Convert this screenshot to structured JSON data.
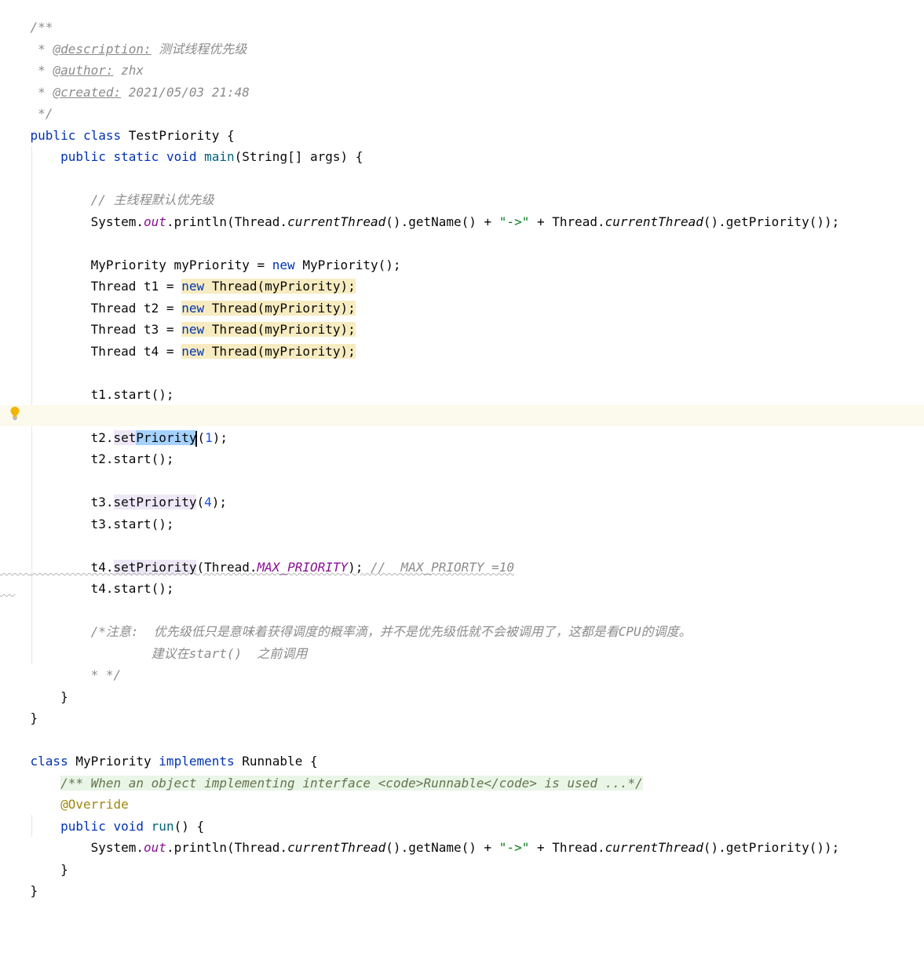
{
  "header_comment": {
    "open": "/**",
    "description_tag": "@description:",
    "description_text": " 测试线程优先级",
    "author_tag": "@author:",
    "author_text": " zhx",
    "created_tag": "@created:",
    "created_text": " 2021/05/03 21:48",
    "close": " */"
  },
  "class_decl": {
    "kw_public": "public",
    "kw_class": "class",
    "name": "TestPriority",
    "brace": " {"
  },
  "main_decl": {
    "kw_public": "public",
    "kw_static": "static",
    "kw_void": "void",
    "method": "main",
    "params": "(String[] args) {"
  },
  "main_comment": "// 主线程默认优先级",
  "print_stmt": {
    "system": "System.",
    "out": "out",
    "println": ".println(Thread.",
    "current_thread_1": "currentThread",
    "get_name": "().getName() + ",
    "arrow": "\"->\"",
    "plus": " + Thread.",
    "current_thread_2": "currentThread",
    "tail": "().getPriority());"
  },
  "my_priority_line": {
    "head": "MyPriority myPriority = ",
    "kw_new": "new",
    "tail": " MyPriority();"
  },
  "thread_lines": [
    {
      "head": "Thread t1 = ",
      "kw_new": "new",
      "tail": " Thread(myPriority)",
      "semi": ";"
    },
    {
      "head": "Thread t2 = ",
      "kw_new": "new",
      "tail": " Thread(myPriority)",
      "semi": ";"
    },
    {
      "head": "Thread t3 = ",
      "kw_new": "new",
      "tail": " Thread(myPriority)",
      "semi": ";"
    },
    {
      "head": "Thread t4 = ",
      "kw_new": "new",
      "tail": " Thread(myPriority)",
      "semi": ";"
    }
  ],
  "t1_start": "t1.start();",
  "t2_set": {
    "head": "t2.",
    "set": "set",
    "priority": "Priority",
    "open": "(",
    "num": "1",
    "close": ");"
  },
  "t2_start": "t2.start();",
  "t3_set": {
    "head": "t3.",
    "method": "setPriority",
    "open": "(",
    "num": "4",
    "close": ");"
  },
  "t3_start": "t3.start();",
  "t4_set": {
    "head": "t4.",
    "method": "setPriority",
    "mid": "(Thread.",
    "const": "MAX_PRIORITY",
    "close": ");",
    "comment": " //  MAX_PRIORTY =10"
  },
  "t4_start": "t4.start();",
  "note_comment": {
    "line1": "/*注意:  优先级低只是意味着获得调度的概率滴，并不是优先级低就不会被调用了，这都是看CPU的调度。",
    "line2": "        建议在start()  之前调用",
    "line3": "* */"
  },
  "close_main": "}",
  "close_class": "}",
  "runnable_decl": {
    "kw_class": "class",
    "name": " MyPriority ",
    "kw_implements": "implements",
    "tail": " Runnable {"
  },
  "runnable_doc": "/** When an object implementing interface <code>Runnable</code> is used ...*/",
  "override": "@Override",
  "run_decl": {
    "kw_public": "public",
    "kw_void": "void",
    "method": "run",
    "tail": "() {"
  },
  "close_run": "}",
  "close_runnable": "}"
}
